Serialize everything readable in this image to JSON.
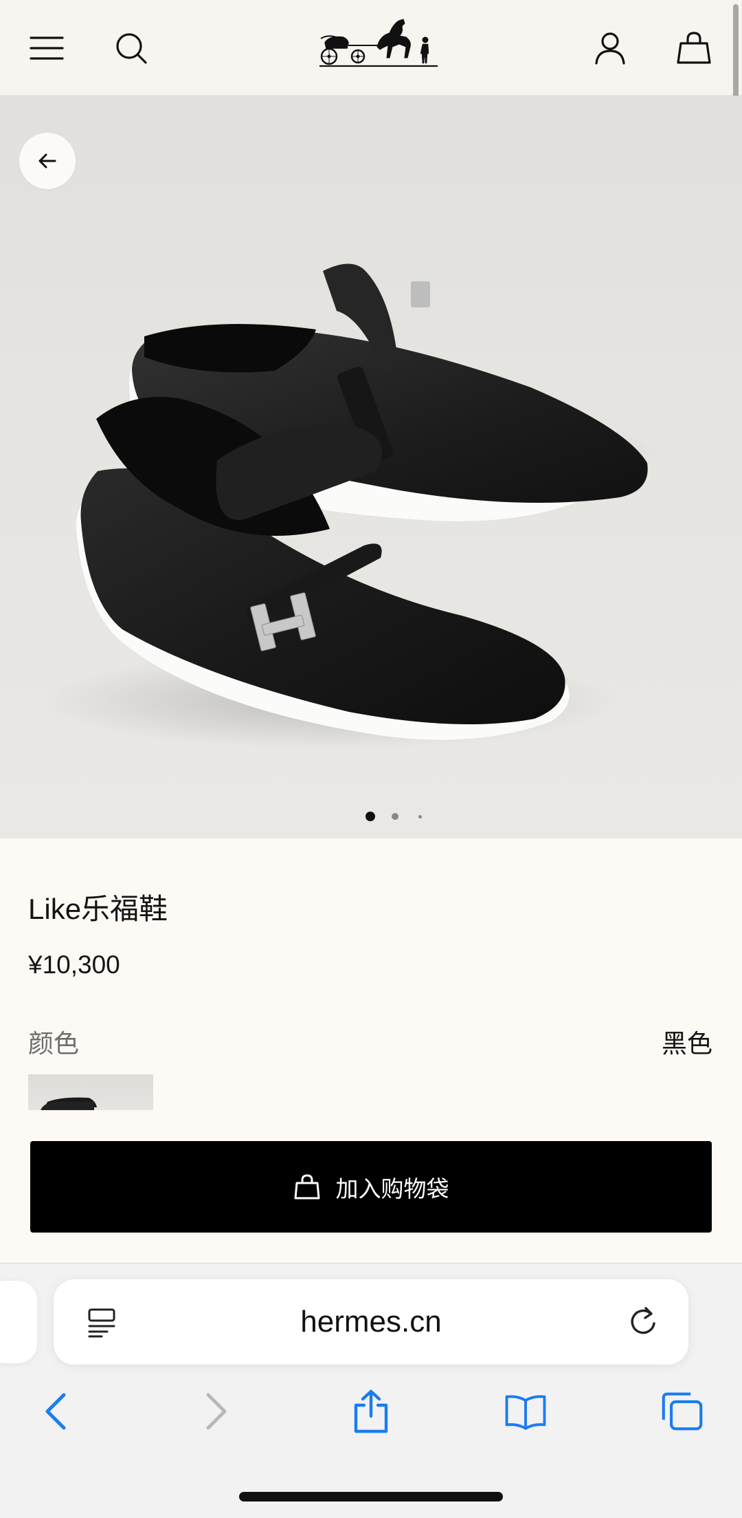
{
  "header": {
    "menu_icon": "menu-icon",
    "search_icon": "search-icon",
    "logo": "hermes-carriage-logo",
    "account_icon": "account-icon",
    "bag_icon": "shopping-bag-icon"
  },
  "hero": {
    "back_icon": "arrow-left-icon",
    "carousel_dots": 3,
    "active_index": 0
  },
  "product": {
    "title": "Like乐福鞋",
    "price": "¥10,300",
    "color_label": "颜色",
    "color_value": "黑色",
    "add_to_bag": "加入购物袋"
  },
  "browser": {
    "url": "hermes.cn",
    "reader_icon": "reader-mode-icon",
    "reload_icon": "reload-icon",
    "toolbar": [
      "back-icon",
      "forward-icon",
      "share-icon",
      "bookmarks-icon",
      "tabs-icon"
    ]
  },
  "colors": {
    "page_bg": "#fdfaf5",
    "header_bg": "#f8f5f0",
    "button_bg": "#000000",
    "safari_blue": "#1a7cf0"
  }
}
